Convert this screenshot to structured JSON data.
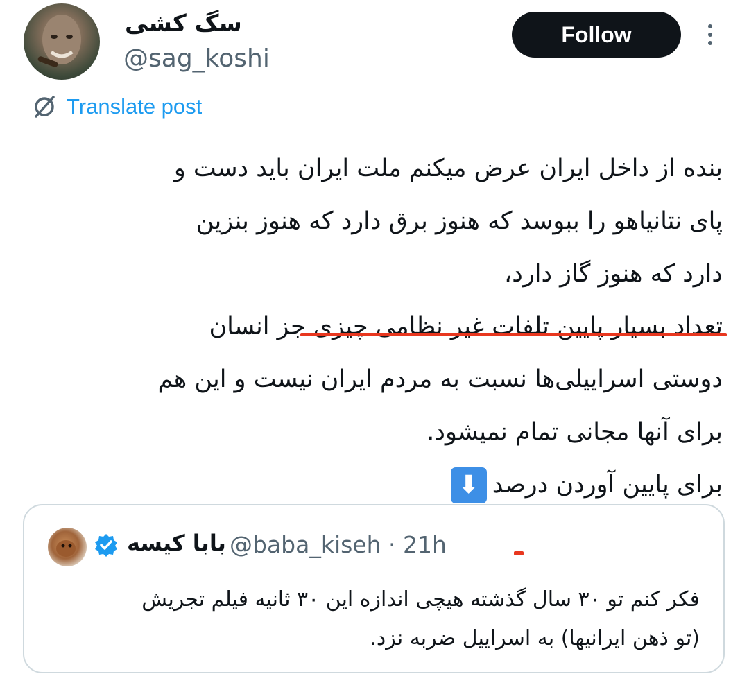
{
  "author": {
    "display_name": "سگ کشی",
    "handle": "@sag_koshi"
  },
  "follow_button": {
    "label": "Follow"
  },
  "translate": {
    "label": "Translate post"
  },
  "tweet": {
    "lines": [
      "بنده از داخل ایران عرض میکنم ملت ایران باید دست و",
      "پای نتانیاهو را ببوسد که هنوز برق دارد که هنوز بنزین",
      "دارد که هنوز گاز دارد،",
      "تعداد بسیار پایین تلفات غیر نظامی چیزی جز انسان",
      "دوستی اسراییلی‌ها نسبت به مردم ایران نیست و این هم",
      "برای آنها مجانی تمام نمیشود.",
      "برای پایین آوردن درصد"
    ],
    "emoji": "⬇"
  },
  "quoted_post": {
    "display_name": "بابا کیسه",
    "handle": "@baba_kiseh",
    "separator": "·",
    "time": "21h",
    "lines": [
      "فکر کنم تو ۳۰ سال گذشته هیچی اندازه این ۳۰ ثانیه فیلم تجریش",
      "(تو ذهن ایرانیها) به اسراییل ضربه نزد."
    ]
  },
  "colors": {
    "accent": "#1d9bf0",
    "secondary_text": "#536471",
    "annotation_red": "#e8371f",
    "border": "#cfd9de"
  }
}
